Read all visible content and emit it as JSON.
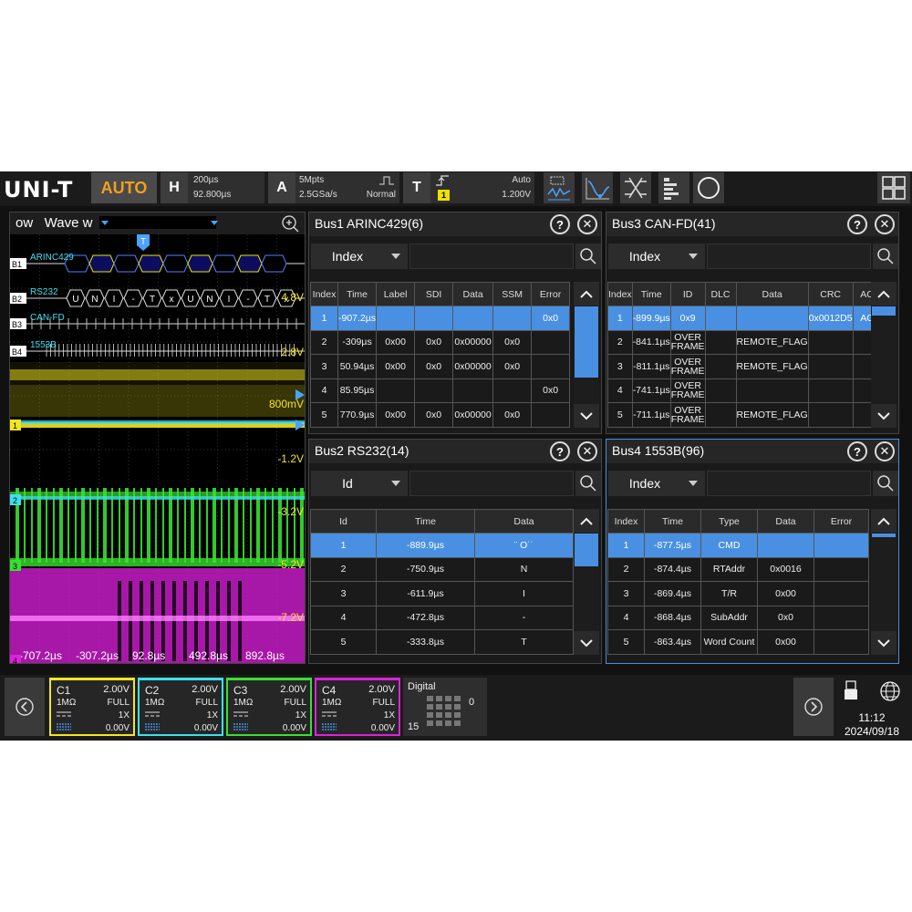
{
  "app": {
    "brand": "UNI-T",
    "auto_label": "AUTO"
  },
  "horizontal": {
    "label": "H",
    "timebase": "200µs",
    "delay": "92.800µs"
  },
  "acquire": {
    "label": "A",
    "memory": "5Mpts",
    "sample_rate": "2.5GSa/s",
    "mode": "Normal"
  },
  "trigger": {
    "label": "T",
    "source": "1",
    "mode": "Auto",
    "level": "1.200V"
  },
  "toolbar_icons": [
    "measure-icon",
    "math-icon",
    "decode-icon",
    "list-icon",
    "search-icon"
  ],
  "layout_icon": "multi-window-icon",
  "wave": {
    "title": "ow   Wave w",
    "bus_labels": [
      {
        "tag": "B1",
        "name": "ARINC429"
      },
      {
        "tag": "B2",
        "name": "RS232"
      },
      {
        "tag": "B3",
        "name": "CAN-FD"
      },
      {
        "tag": "B4",
        "name": "1553B"
      }
    ],
    "rs232_chars": [
      "U",
      "N",
      "I",
      "-",
      "T",
      "x",
      "U",
      "N",
      "I",
      "-",
      "T",
      "x"
    ],
    "voltage_labels": [
      "4.8V",
      "2.8V",
      "800mV",
      "-1.2V",
      "-3.2V",
      "-5.2V",
      "-7.2V"
    ],
    "time_labels": [
      "-707.2µs",
      "-307.2µs",
      "92.8µs",
      "492.8µs",
      "892.8µs"
    ],
    "channel_markers": [
      "1",
      "2",
      "3",
      "4"
    ],
    "trigger_marker": "T"
  },
  "bus1": {
    "title": "Bus1 ARINC429(6)",
    "filter": "Index",
    "columns": [
      "Index",
      "Time",
      "Label",
      "SDI",
      "Data",
      "SSM",
      "Error"
    ],
    "rows": [
      [
        "1",
        "-907.2µs",
        "",
        "",
        "",
        "",
        "0x0"
      ],
      [
        "2",
        "-309µs",
        "0x00",
        "0x0",
        "0x00000",
        "0x0",
        ""
      ],
      [
        "3",
        "50.94µs",
        "0x00",
        "0x0",
        "0x00000",
        "0x0",
        ""
      ],
      [
        "4",
        "85.95µs",
        "",
        "",
        "",
        "",
        "0x0"
      ],
      [
        "5",
        "770.9µs",
        "0x00",
        "0x0",
        "0x00000",
        "0x0",
        ""
      ]
    ]
  },
  "bus3": {
    "title": "Bus3 CAN-FD(41)",
    "filter": "Index",
    "columns": [
      "Index",
      "Time",
      "ID",
      "DLC",
      "Data",
      "CRC",
      "ACK"
    ],
    "rows": [
      [
        "1",
        "-899.9µs",
        "0x9",
        "",
        "",
        "0x0012D5",
        "ACK"
      ],
      [
        "2",
        "-841.1µs",
        "OVER FRAME",
        "",
        "REMOTE_FLAG",
        "",
        ""
      ],
      [
        "3",
        "-811.1µs",
        "OVER FRAME",
        "",
        "REMOTE_FLAG",
        "",
        ""
      ],
      [
        "4",
        "-741.1µs",
        "OVER FRAME",
        "",
        "",
        "",
        ""
      ],
      [
        "5",
        "-711.1µs",
        "OVER FRAME",
        "",
        "REMOTE_FLAG",
        "",
        ""
      ]
    ]
  },
  "bus2": {
    "title": "Bus2 RS232(14)",
    "filter": "Id",
    "columns": [
      "Id",
      "Time",
      "Data"
    ],
    "rows": [
      [
        "1",
        "-889.9µs",
        "¨ O˙˙"
      ],
      [
        "2",
        "-750.9µs",
        "N"
      ],
      [
        "3",
        "-611.9µs",
        "I"
      ],
      [
        "4",
        "-472.8µs",
        "-"
      ],
      [
        "5",
        "-333.8µs",
        "T"
      ]
    ]
  },
  "bus4": {
    "title": "Bus4 1553B(96)",
    "filter": "Index",
    "columns": [
      "Index",
      "Time",
      "Type",
      "Data",
      "Error"
    ],
    "rows": [
      [
        "1",
        "-877.5µs",
        "CMD",
        "",
        ""
      ],
      [
        "2",
        "-874.4µs",
        "RTAddr",
        "0x0016",
        ""
      ],
      [
        "3",
        "-869.4µs",
        "T/R",
        "0x00",
        ""
      ],
      [
        "4",
        "-868.4µs",
        "SubAddr",
        "0x0",
        ""
      ],
      [
        "5",
        "-863.4µs",
        "Word Count",
        "0x00",
        ""
      ]
    ]
  },
  "channels": [
    {
      "name": "C1",
      "volts": "2.00V",
      "impedance": "1MΩ",
      "bandwidth": "FULL",
      "probe": "1X",
      "offset": "0.00V",
      "color": "#f4e61e"
    },
    {
      "name": "C2",
      "volts": "2.00V",
      "impedance": "1MΩ",
      "bandwidth": "FULL",
      "probe": "1X",
      "offset": "0.00V",
      "color": "#3ee0f0"
    },
    {
      "name": "C3",
      "volts": "2.00V",
      "impedance": "1MΩ",
      "bandwidth": "FULL",
      "probe": "1X",
      "offset": "0.00V",
      "color": "#38e030"
    },
    {
      "name": "C4",
      "volts": "2.00V",
      "impedance": "1MΩ",
      "bandwidth": "FULL",
      "probe": "1X",
      "offset": "0.00V",
      "color": "#e020e0"
    }
  ],
  "digital": {
    "label": "Digital",
    "low": "0",
    "high": "15"
  },
  "status": {
    "time": "11:12",
    "date": "2024/09/18"
  },
  "colors": {
    "ch1": "#f4e61e",
    "ch2": "#3ee0f0",
    "ch3": "#38e030",
    "ch4": "#e020e0",
    "selection": "#4a90e2",
    "brand_accent": "#f0a020"
  }
}
